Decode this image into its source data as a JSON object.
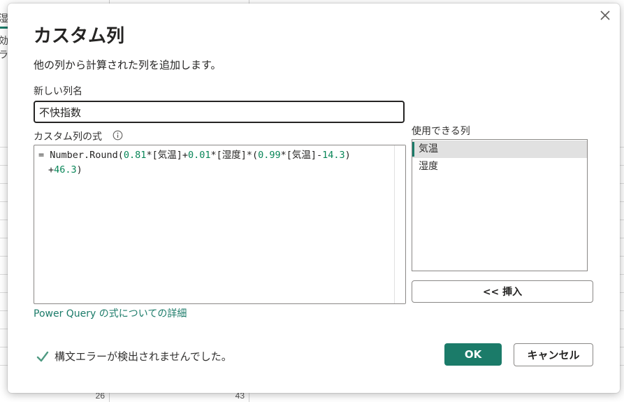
{
  "background": {
    "left_fragments": [
      "湿度",
      "効",
      "ラ"
    ],
    "bottom_values": [
      "26",
      "43"
    ]
  },
  "dialog": {
    "title": "カスタム列",
    "description": "他の列から計算された列を追加します。",
    "new_column_label": "新しい列名",
    "new_column_value": "不快指数",
    "formula_label": "カスタム列の式",
    "formula_line1": "= Number.Round(0.81*[気温]+0.01*[湿度]*(0.99*[気温]-14.3)",
    "formula_line2": "+46.3)",
    "formula_tokens_line1": [
      {
        "t": "= Number.Round(",
        "c": ""
      },
      {
        "t": "0.81",
        "c": "num"
      },
      {
        "t": "*[気温]+",
        "c": ""
      },
      {
        "t": "0.01",
        "c": "num"
      },
      {
        "t": "*[湿度]*(",
        "c": ""
      },
      {
        "t": "0.99",
        "c": "num"
      },
      {
        "t": "*[気温]-",
        "c": ""
      },
      {
        "t": "14.3",
        "c": "num"
      },
      {
        "t": ")",
        "c": ""
      }
    ],
    "formula_tokens_line2": [
      {
        "t": "+",
        "c": ""
      },
      {
        "t": "46.3",
        "c": "num"
      },
      {
        "t": ")",
        "c": ""
      }
    ],
    "learn_more_link": "Power Query の式についての詳細",
    "available_columns_label": "使用できる列",
    "available_columns": [
      "気温",
      "湿度"
    ],
    "selected_column": "気温",
    "insert_button": "<< 挿入",
    "status_message": "構文エラーが検出されませんでした。",
    "ok_button": "OK",
    "cancel_button": "キャンセル"
  },
  "colors": {
    "accent": "#1b7b69",
    "number_token": "#098658",
    "check": "#4f9a82"
  },
  "icons": {
    "close": "close-icon",
    "info": "info-icon",
    "check": "checkmark-icon"
  }
}
